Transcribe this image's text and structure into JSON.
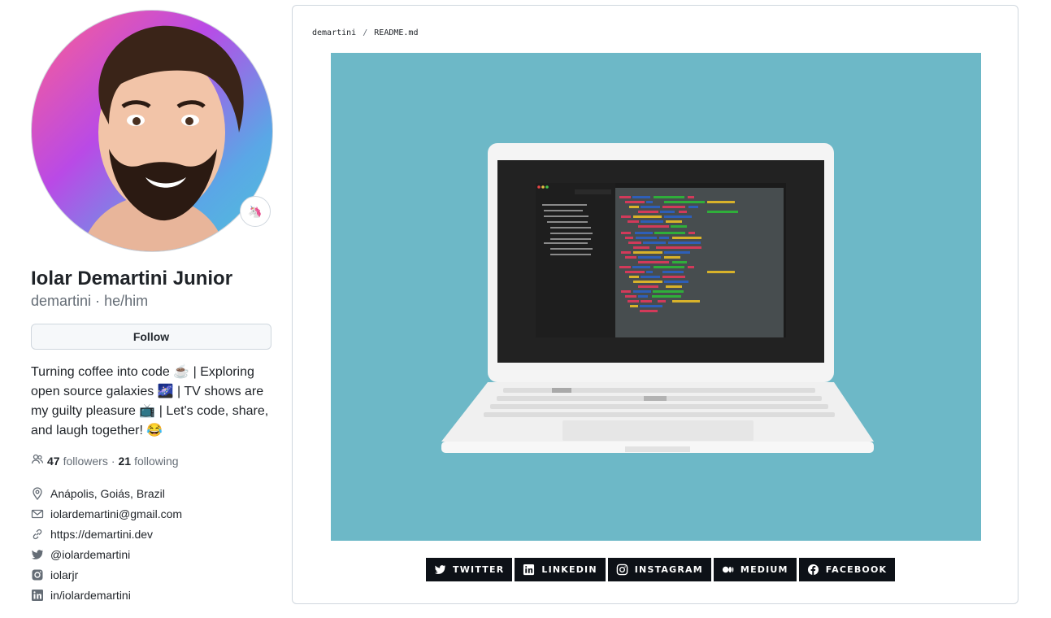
{
  "profile": {
    "name": "Iolar Demartini Junior",
    "login": "demartini",
    "pronouns": "he/him",
    "status_emoji": "🦄",
    "follow_label": "Follow",
    "bio": "Turning coffee into code ☕ | Exploring open source galaxies 🌌 | TV shows are my guilty pleasure 📺 | Let's code, share, and laugh together! 😂",
    "followers_count": "47",
    "followers_label": "followers",
    "following_count": "21",
    "following_label": "following",
    "separator": "·"
  },
  "details": {
    "location": "Anápolis, Goiás, Brazil",
    "email": "iolardemartini@gmail.com",
    "website": "https://demartini.dev",
    "twitter": "@iolardemartini",
    "instagram": "iolarjr",
    "linkedin": "in/iolardemartini"
  },
  "readme": {
    "repo": "demartini",
    "separator": "/",
    "file": "README.md"
  },
  "badges": {
    "twitter": "TWITTER",
    "linkedin": "LINKEDIN",
    "instagram": "INSTAGRAM",
    "medium": "MEDIUM",
    "facebook": "FACEBOOK"
  },
  "colors": {
    "hero_bg": "#6db8c7",
    "badge_bg": "#0d1117",
    "border": "#d0d7de",
    "muted_text": "#656d76"
  }
}
